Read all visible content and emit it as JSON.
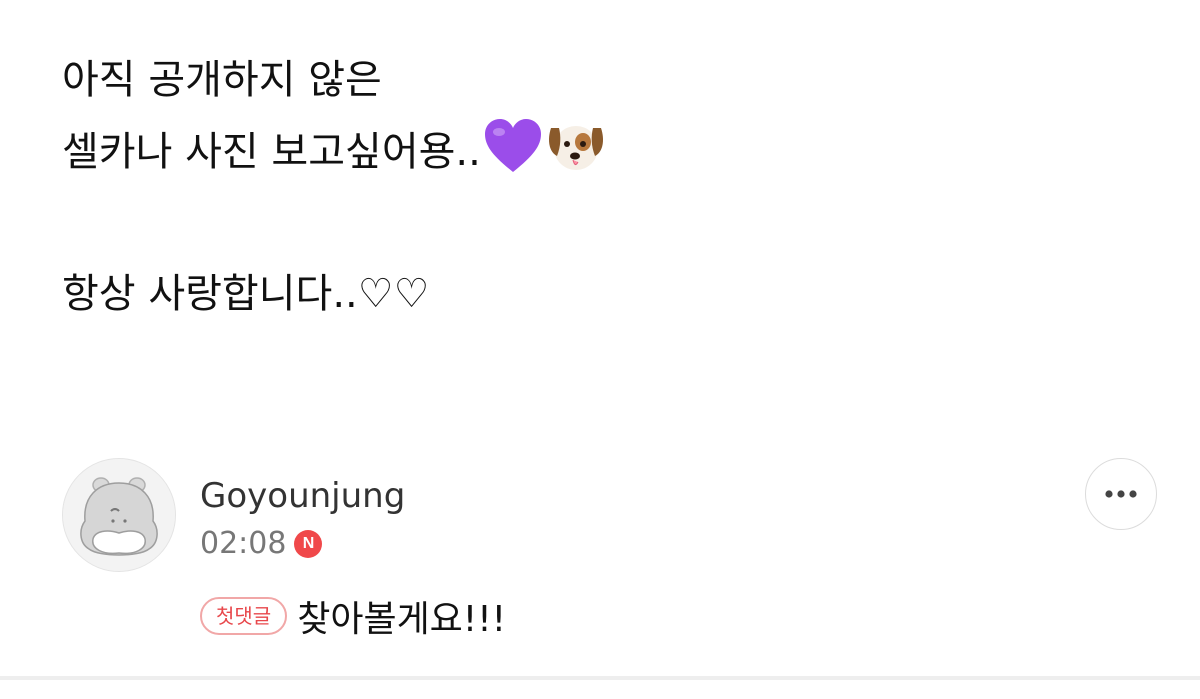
{
  "post": {
    "lines": [
      "아직 공개하지 않은",
      "셀카나 사진 보고싶어용..",
      "",
      "항상 사랑합니다..♡♡"
    ],
    "line2_emojis": [
      "purple-heart-icon",
      "dog-face-icon"
    ],
    "emoji_colors": {
      "purple_heart": "#9b4dea"
    }
  },
  "comment": {
    "author": "Goyounjung",
    "time": "02:08",
    "new_badge": "N",
    "first_comment_badge": "첫댓글",
    "text": "찾아볼게요!!!",
    "colors": {
      "new_badge": "#f0484a",
      "first_badge_text": "#e8474b",
      "first_badge_border": "#f1a7a7"
    }
  }
}
